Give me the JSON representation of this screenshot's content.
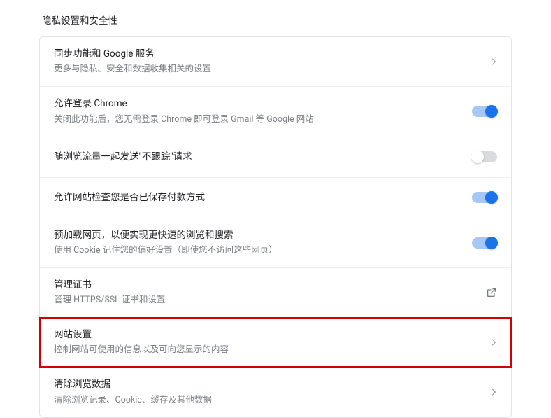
{
  "section": {
    "title": "隐私设置和安全性"
  },
  "rows": [
    {
      "name": "sync-google-services",
      "title": "同步功能和 Google 服务",
      "sub": "更多与隐私、安全和数据收集相关的设置",
      "control": "chevron",
      "highlight": false
    },
    {
      "name": "allow-chrome-signin",
      "title": "允许登录 Chrome",
      "sub": "关闭此功能后，您无需登录 Chrome 即可登录 Gmail 等 Google 网站",
      "control": "toggle",
      "toggle_on": true,
      "highlight": false
    },
    {
      "name": "do-not-track",
      "title": "随浏览流量一起发送\"不跟踪\"请求",
      "sub": "",
      "control": "toggle",
      "toggle_on": false,
      "highlight": false
    },
    {
      "name": "payment-check",
      "title": "允许网站检查您是否已保存付款方式",
      "sub": "",
      "control": "toggle",
      "toggle_on": true,
      "highlight": false
    },
    {
      "name": "preload-pages",
      "title": "预加载网页，以便实现更快速的浏览和搜索",
      "sub": "使用 Cookie 记住您的偏好设置（即使您不访问这些网页）",
      "control": "toggle",
      "toggle_on": true,
      "highlight": false
    },
    {
      "name": "manage-certificates",
      "title": "管理证书",
      "sub": "管理 HTTPS/SSL 证书和设置",
      "control": "external",
      "highlight": false
    },
    {
      "name": "site-settings",
      "title": "网站设置",
      "sub": "控制网站可使用的信息以及可向您显示的内容",
      "control": "chevron",
      "highlight": true
    },
    {
      "name": "clear-browsing-data",
      "title": "清除浏览数据",
      "sub": "清除浏览记录、Cookie、缓存及其他数据",
      "control": "chevron",
      "highlight": false
    }
  ]
}
